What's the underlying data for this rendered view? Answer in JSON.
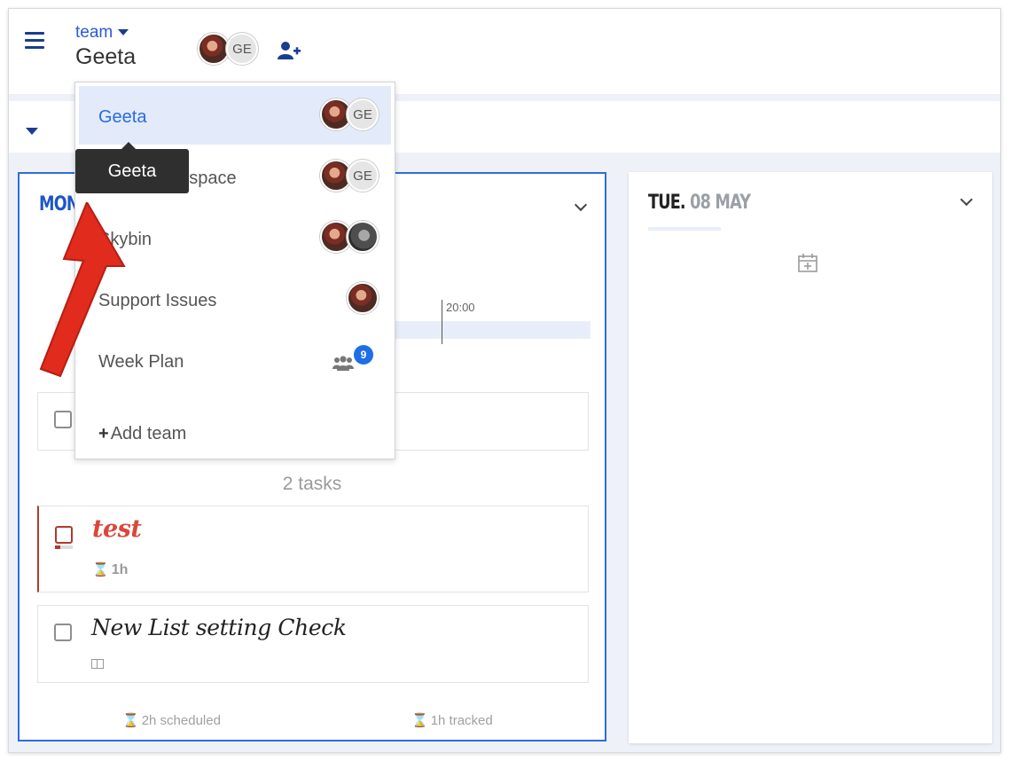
{
  "header": {
    "team_label": "team",
    "team_name": "Geeta",
    "avatars": [
      {
        "type": "photo"
      },
      {
        "type": "initials",
        "text": "GE"
      }
    ],
    "add_user_icon": "user-plus-icon"
  },
  "days": {
    "mon": {
      "label": "MON"
    },
    "tue": {
      "day": "TUE.",
      "date": "08 MAY"
    }
  },
  "timeline": {
    "time_label": "20:00"
  },
  "tasks_summary": "2 tasks",
  "tasks": [
    {
      "title": "test",
      "duration": "1h",
      "accent": "#d9483b"
    },
    {
      "title": "New List setting Check"
    }
  ],
  "footer": {
    "scheduled": "2h scheduled",
    "tracked": "1h tracked"
  },
  "dropdown": {
    "items": [
      {
        "label": "Geeta",
        "avatars": [
          "photo",
          "GE"
        ]
      },
      {
        "label": "Geeta workspace",
        "avatars": [
          "photo",
          "GE"
        ]
      },
      {
        "label": "Skybin",
        "avatars": [
          "photo",
          "photo"
        ]
      },
      {
        "label": "Support Issues",
        "avatars": [
          "photo"
        ]
      },
      {
        "label": "Week Plan",
        "badge": "9"
      }
    ],
    "add_team": "Add team"
  },
  "tooltip": "Geeta",
  "colors": {
    "accent": "#2a6be0",
    "brand": "#1a3d8f",
    "danger": "#d9483b",
    "badge": "#1f6ee6"
  }
}
